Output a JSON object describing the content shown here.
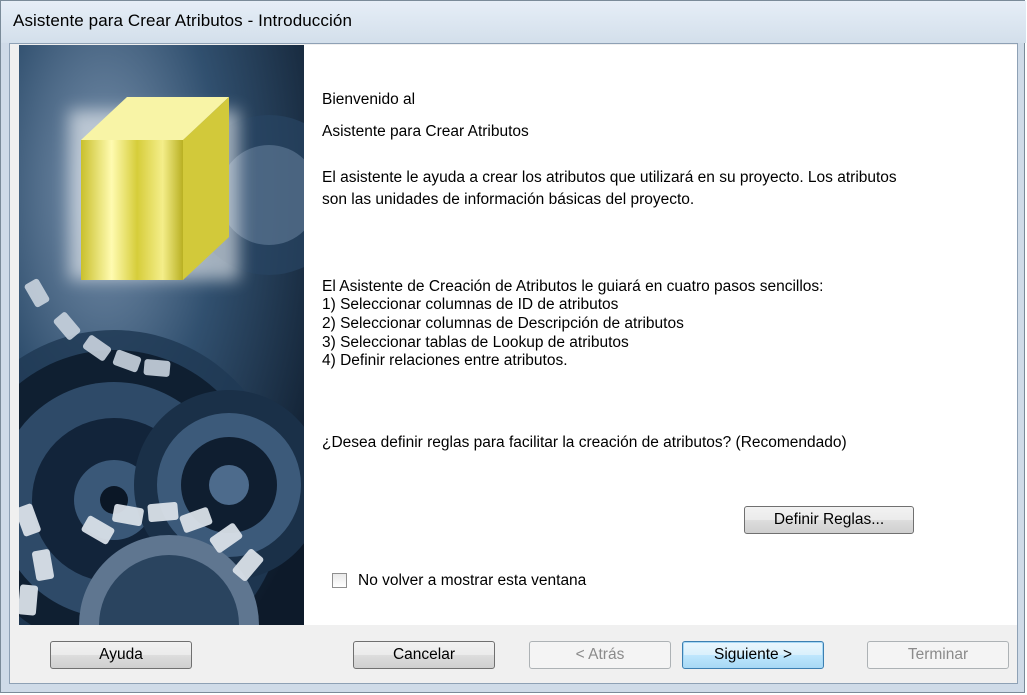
{
  "window": {
    "title": "Asistente para Crear Atributos - Introducción"
  },
  "content": {
    "welcome_line1": "Bienvenido al",
    "welcome_line2": "Asistente para Crear Atributos",
    "intro_line1": "El asistente le ayuda a crear los atributos que utilizará en su proyecto. Los atributos",
    "intro_line2": "son las unidades de información básicas del proyecto.",
    "steps_intro": "El Asistente de Creación de Atributos le guiará en cuatro pasos sencillos:",
    "steps": [
      "1) Seleccionar columnas de ID de atributos",
      "2) Seleccionar columnas de Descripción de atributos",
      "3) Seleccionar tablas de Lookup de atributos",
      "4) Definir relaciones entre atributos."
    ],
    "rules_question": "¿Desea definir reglas para facilitar la creación de atributos? (Recomendado)",
    "define_rules_label": "Definir Reglas...",
    "dont_show_label": "No volver a mostrar esta ventana",
    "dont_show_checked": false
  },
  "buttons": {
    "help": "Ayuda",
    "cancel": "Cancelar",
    "back": "< Atrás",
    "next": "Siguiente >",
    "finish": "Terminar"
  },
  "colors": {
    "banner_dark": "#16283d",
    "cube_yellow": "#f2ea7a",
    "default_button_border": "#3c7fb1"
  }
}
